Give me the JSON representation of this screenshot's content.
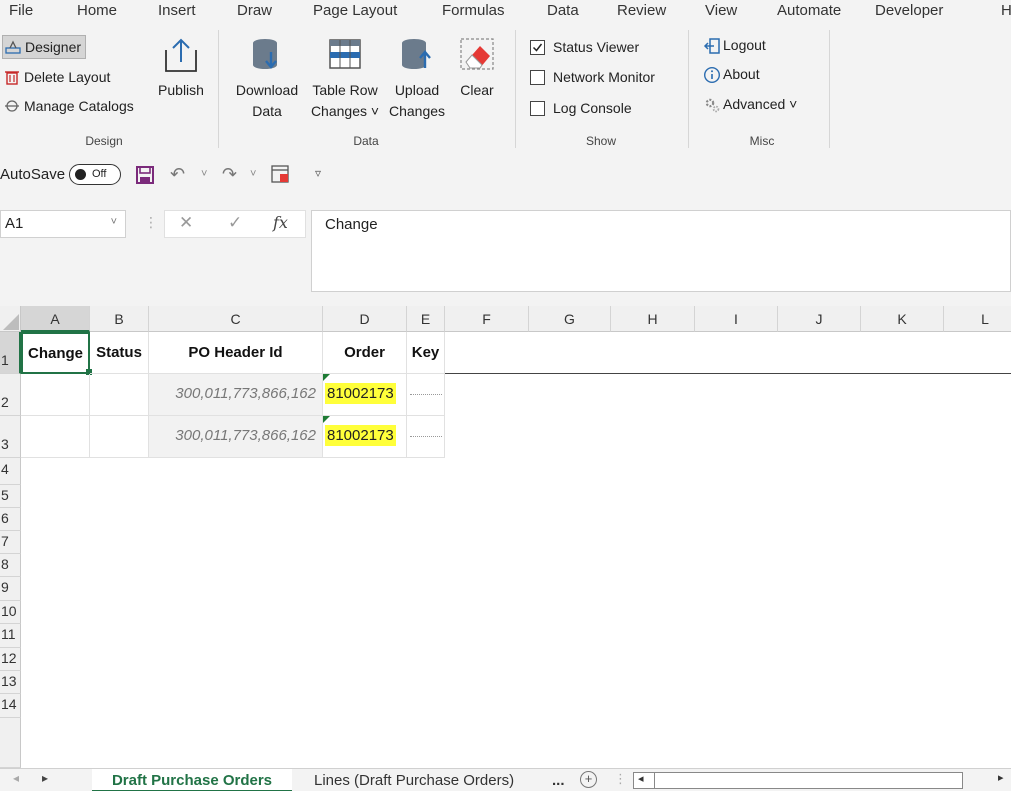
{
  "menu": [
    "File",
    "Home",
    "Insert",
    "Draw",
    "Page Layout",
    "Formulas",
    "Data",
    "Review",
    "View",
    "Automate",
    "Developer",
    "H"
  ],
  "ribbon": {
    "design": {
      "designer": "Designer",
      "delete_layout": "Delete Layout",
      "manage_catalogs": "Manage Catalogs",
      "publish": "Publish",
      "label": "Design"
    },
    "data": {
      "download_1": "Download",
      "download_2": "Data",
      "table_row_1": "Table Row",
      "table_row_2": "Changes",
      "upload_1": "Upload",
      "upload_2": "Changes",
      "clear": "Clear",
      "label": "Data"
    },
    "show": {
      "status_viewer": "Status Viewer",
      "status_viewer_checked": true,
      "network_monitor": "Network Monitor",
      "log_console": "Log Console",
      "label": "Show"
    },
    "misc": {
      "logout": "Logout",
      "about": "About",
      "advanced": "Advanced",
      "label": "Misc"
    }
  },
  "qat": {
    "autosave": "AutoSave",
    "toggle": "Off"
  },
  "formula_bar": {
    "name_box": "A1",
    "fx": "fx",
    "value": "Change"
  },
  "columns": [
    "A",
    "B",
    "C",
    "D",
    "E",
    "F",
    "G",
    "H",
    "I",
    "J",
    "K",
    "L"
  ],
  "rows": [
    "1",
    "2",
    "3",
    "4",
    "5",
    "6",
    "7",
    "8",
    "9",
    "10",
    "11",
    "12",
    "13",
    "14"
  ],
  "headers": {
    "change": "Change",
    "status": "Status",
    "po_header_id": "PO Header Id",
    "order": "Order",
    "key": "Key"
  },
  "data_rows": [
    {
      "po_header_id": "300,011,773,866,162",
      "order": "81002173"
    },
    {
      "po_header_id": "300,011,773,866,162",
      "order": "81002173"
    }
  ],
  "tabs": {
    "active": "Draft Purchase Orders",
    "other": "Lines (Draft Purchase Orders)",
    "more": "..."
  },
  "colors": {
    "highlight": "#ffff3a",
    "ribbon_bg": "#f3f3f3",
    "tab_active": "#217346"
  }
}
